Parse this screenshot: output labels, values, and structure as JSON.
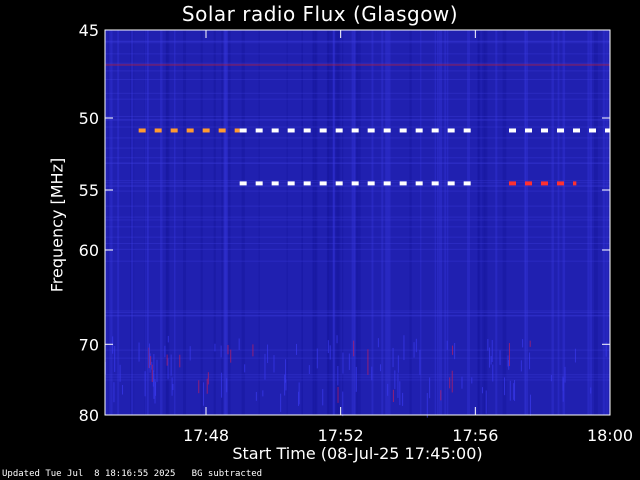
{
  "chart_data": {
    "type": "heatmap",
    "title": "Solar radio Flux (Glasgow)",
    "ylabel": "Frequency [MHz]",
    "xlabel": "Start Time (08-Jul-25 17:45:00)",
    "y_ticks": [
      45,
      50,
      55,
      60,
      70,
      80
    ],
    "x_ticks": [
      "17:48",
      "17:52",
      "17:56",
      "18:00"
    ],
    "x_range": [
      "17:45",
      "18:00"
    ],
    "y_range_mhz": [
      45,
      80
    ],
    "y_scale": "reciprocal",
    "bright_features": [
      {
        "freq_mhz": 50.8,
        "start": "17:46",
        "end": "17:49",
        "color": "#ff9a30"
      },
      {
        "freq_mhz": 50.8,
        "start": "17:49",
        "end": "17:56",
        "color": "#ffffff"
      },
      {
        "freq_mhz": 50.8,
        "start": "17:57",
        "end": "18:00",
        "color": "#ffffff"
      },
      {
        "freq_mhz": 54.5,
        "start": "17:49",
        "end": "17:56",
        "color": "#ffffff"
      },
      {
        "freq_mhz": 54.5,
        "start": "17:57",
        "end": "17:59",
        "color": "#ff3030"
      }
    ],
    "colors": {
      "background": "#2020b0",
      "mid": "#1010c0",
      "hot": "#ff3030",
      "max": "#ffffff"
    },
    "grid": false
  },
  "footer": "Updated Tue Jul  8 18:16:55 2025   BG subtracted"
}
